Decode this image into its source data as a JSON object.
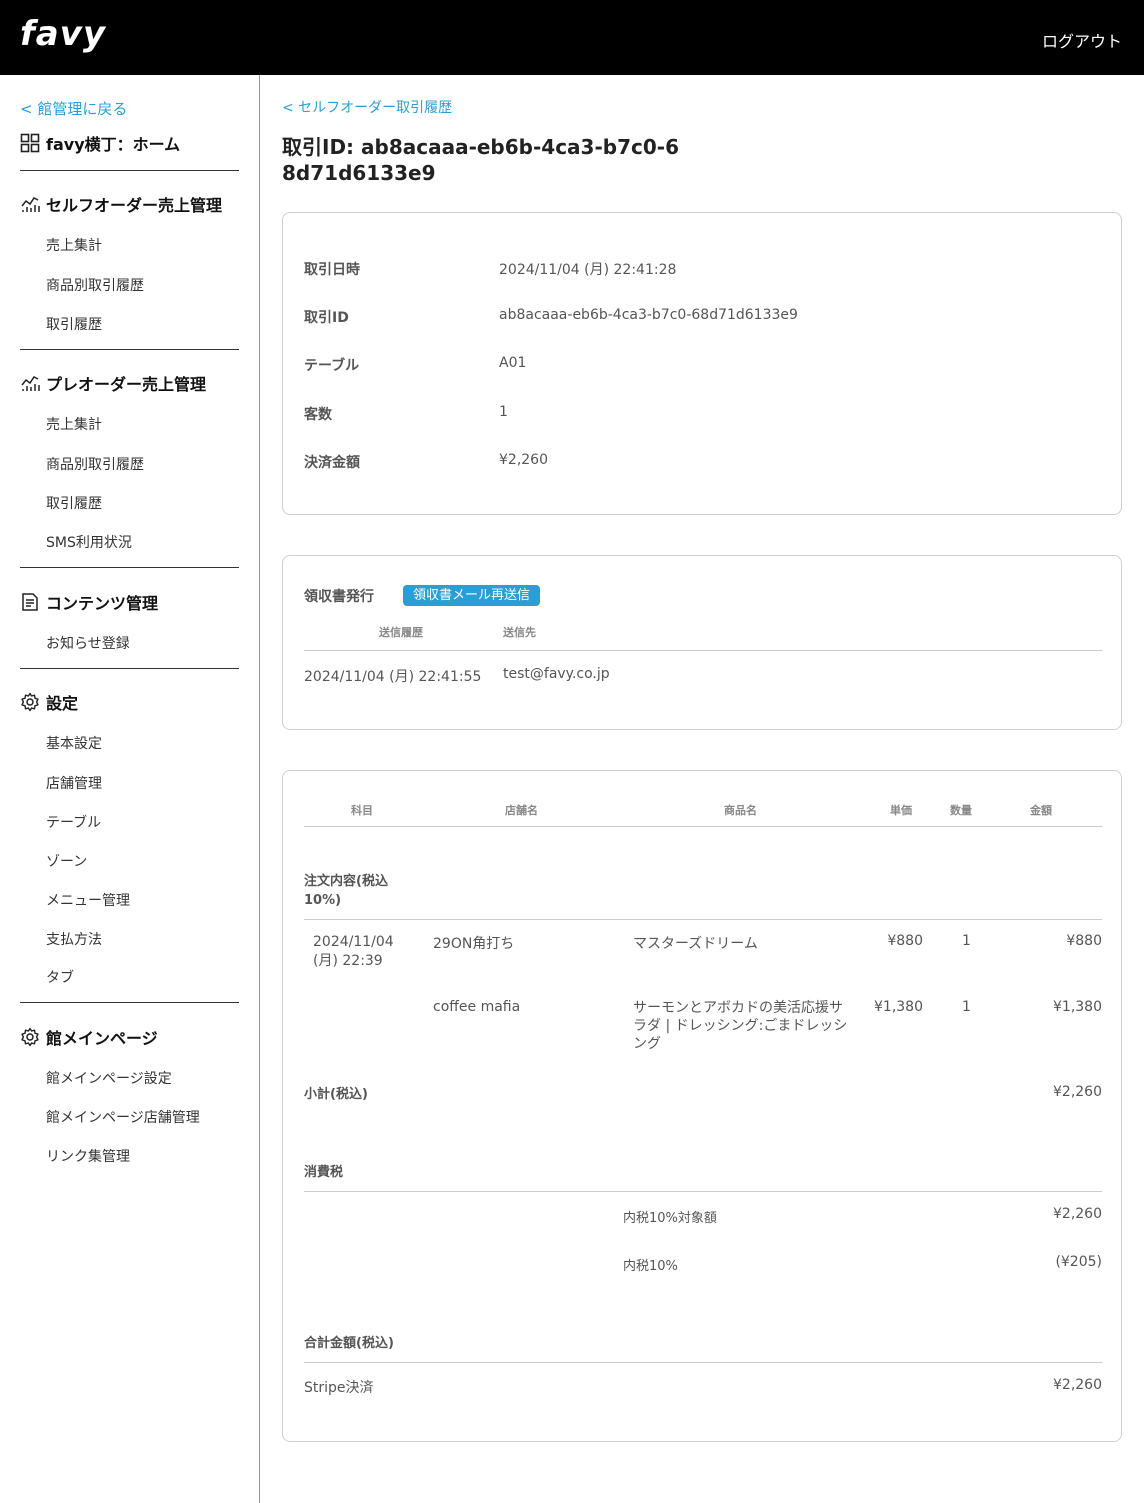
{
  "header": {
    "logo": "favy",
    "logout_label": "ログアウト"
  },
  "sidebar": {
    "back_label": "< 館管理に戻る",
    "home_label": "favy横丁：ホーム",
    "sections": [
      {
        "title": "セルフオーダー売上管理",
        "icon": "chart-icon",
        "items": [
          "売上集計",
          "商品別取引履歴",
          "取引履歴"
        ]
      },
      {
        "title": "プレオーダー売上管理",
        "icon": "chart-icon",
        "items": [
          "売上集計",
          "商品別取引履歴",
          "取引履歴",
          "SMS利用状況"
        ]
      },
      {
        "title": "コンテンツ管理",
        "icon": "document-icon",
        "items": [
          "お知らせ登録"
        ]
      },
      {
        "title": "設定",
        "icon": "gear-icon",
        "items": [
          "基本設定",
          "店舗管理",
          "テーブル",
          "ゾーン",
          "メニュー管理",
          "支払方法",
          "タブ"
        ]
      },
      {
        "title": "館メインページ",
        "icon": "gear-icon",
        "items": [
          "館メインページ設定",
          "館メインページ店舗管理",
          "リンク集管理"
        ]
      }
    ]
  },
  "main": {
    "breadcrumb": "< セルフオーダー取引履歴",
    "title": "取引ID: ab8acaaa-eb6b-4ca3-b7c0-68d71d6133e9",
    "details": [
      {
        "label": "取引日時",
        "value": "2024/11/04 (月) 22:41:28"
      },
      {
        "label": "取引ID",
        "value": "ab8acaaa-eb6b-4ca3-b7c0-68d71d6133e9"
      },
      {
        "label": "テーブル",
        "value": "A01"
      },
      {
        "label": "客数",
        "value": "1"
      },
      {
        "label": "決済金額",
        "value": "¥2,260"
      }
    ],
    "receipt": {
      "title": "領収書発行",
      "resend_label": "領収書メール再送信",
      "col_history": "送信履歴",
      "col_dest": "送信先",
      "rows": [
        {
          "sent_at": "2024/11/04 (月) 22:41:55",
          "to": "test@favy.co.jp"
        }
      ]
    },
    "order": {
      "headers": [
        "科目",
        "店舗名",
        "商品名",
        "単価",
        "数量",
        "金額"
      ],
      "section_label": "注文内容(税込 10%)",
      "items": [
        {
          "date": "2024/11/04 (月) 22:39",
          "store": "29ON角打ち",
          "product": "マスターズドリーム",
          "unit": "¥880",
          "qty": "1",
          "amount": "¥880"
        },
        {
          "date": "",
          "store": "coffee mafia",
          "product": "サーモンとアボカドの美活応援サラダ | ドレッシング:ごまドレッシング",
          "unit": "¥1,380",
          "qty": "1",
          "amount": "¥1,380"
        }
      ],
      "subtotal_label": "小計(税込)",
      "subtotal": "¥2,260",
      "tax_label": "消費税",
      "tax_rows": [
        {
          "label": "内税10%対象額",
          "value": "¥2,260"
        },
        {
          "label": "内税10%",
          "value": "(¥205)"
        }
      ],
      "total_label": "合計金額(税込)",
      "payment_label": "Stripe決済",
      "payment_value": "¥2,260"
    }
  }
}
